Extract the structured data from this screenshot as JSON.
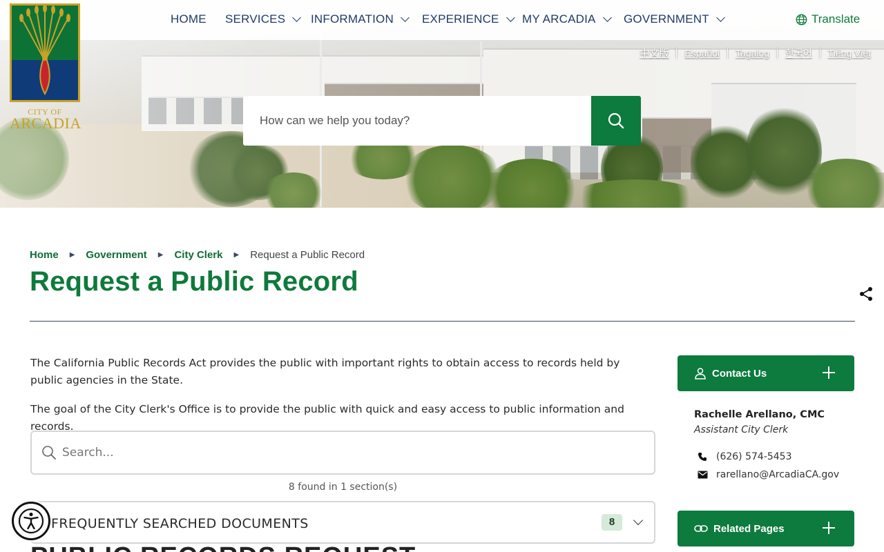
{
  "nav": {
    "items": [
      {
        "label": "HOME",
        "dropdown": false
      },
      {
        "label": "SERVICES",
        "dropdown": true
      },
      {
        "label": "INFORMATION",
        "dropdown": true
      },
      {
        "label": "EXPERIENCE",
        "dropdown": true
      },
      {
        "label": "MY ARCADIA",
        "dropdown": true
      },
      {
        "label": "GOVERNMENT",
        "dropdown": true
      }
    ],
    "translate_label": "Translate"
  },
  "logo": {
    "line1": "CITY OF",
    "line2": "ARCADIA"
  },
  "languages": [
    "中文版",
    "Español",
    "Tagalog",
    "한국어",
    "Tiếng Việt"
  ],
  "hero_search": {
    "placeholder": "How can we help you today?"
  },
  "breadcrumb": {
    "items": [
      "Home",
      "Government",
      "City Clerk"
    ],
    "current": "Request a Public Record"
  },
  "page_title": "Request a Public Record",
  "main": {
    "paragraphs": [
      "The California Public Records Act provides the public with important rights to obtain access to records held by public agencies in the State.",
      "The goal of the City Clerk's Office is to provide the public with quick and easy access to public information and records."
    ],
    "search_placeholder": "Search...",
    "found_text": "8 found in 1 section(s)",
    "accordion": {
      "title": "FREQUENTLY SEARCHED DOCUMENTS",
      "count": "8"
    },
    "next_heading": "PUBLIC RECORDS REQUEST"
  },
  "sidebar": {
    "contact_label": "Contact Us",
    "contact_name": "Rachelle Arellano, CMC",
    "contact_role": "Assistant City Clerk",
    "phone": "(626) 574-5453",
    "email": "rarellano@ArcadiaCA.gov",
    "related_label": "Related Pages"
  },
  "colors": {
    "brand_green": "#0d7a3e",
    "nav_text": "#1f3b66",
    "title_green": "#0e7a3b"
  }
}
